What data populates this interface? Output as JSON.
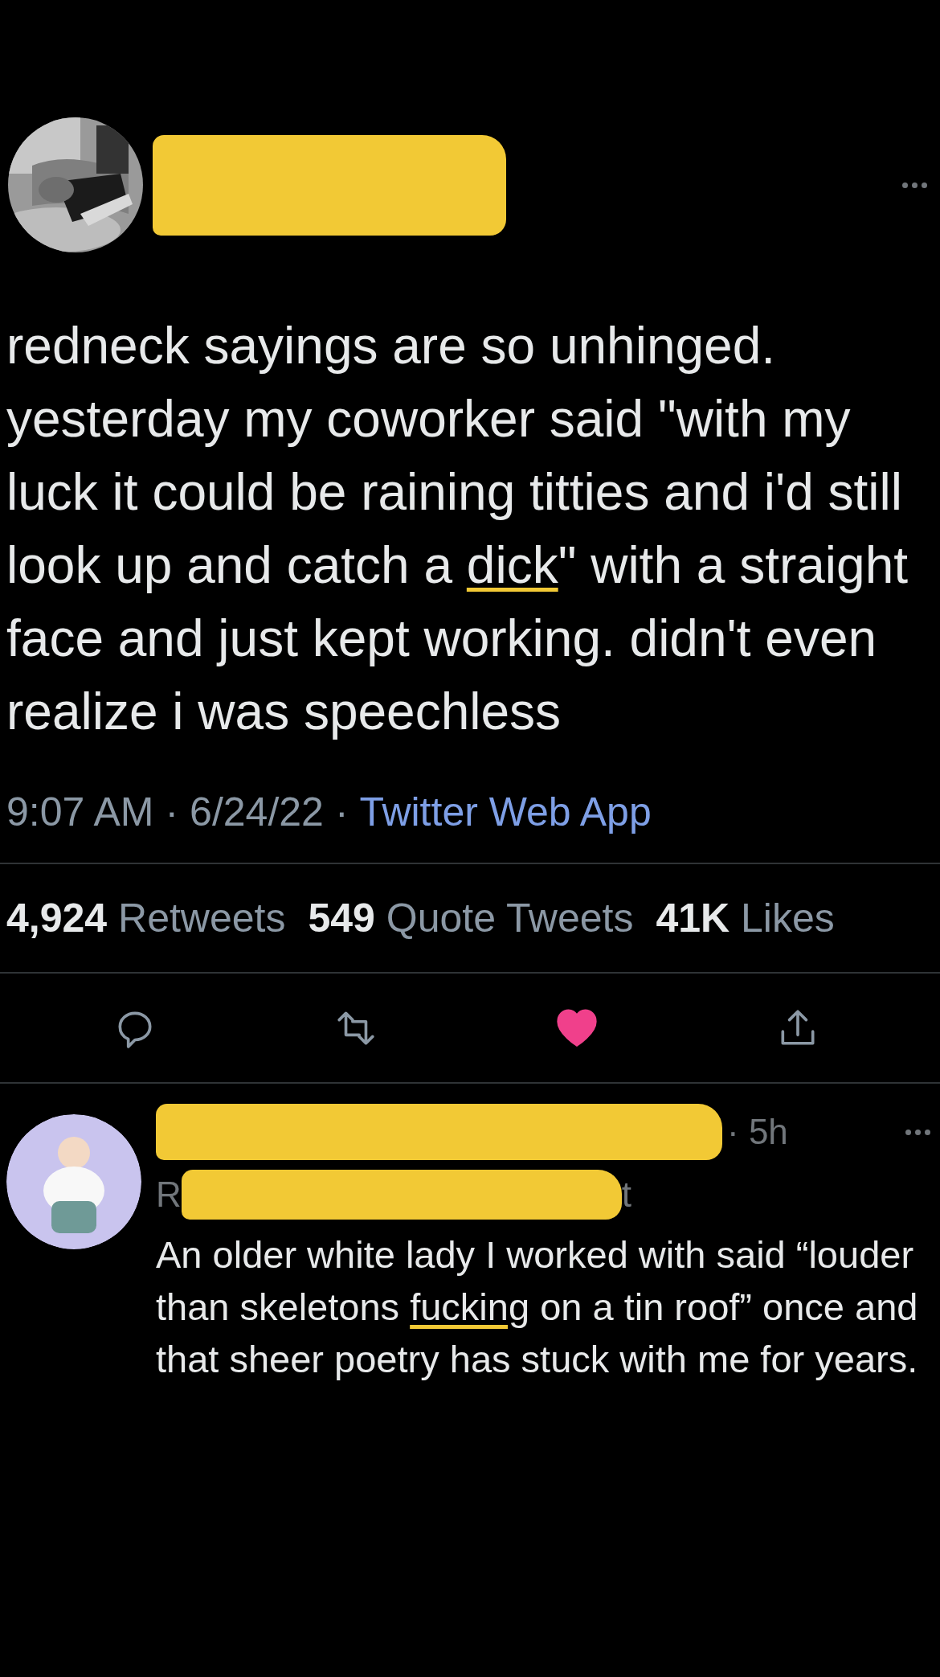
{
  "tweet": {
    "text": [
      {
        "text": "redneck sayings are so unhinged. yesterday my coworker said \"with my luck it could be raining titties and i'd still look up and catch a ",
        "censored": false
      },
      {
        "text": "dick",
        "censored": true
      },
      {
        "text": "\" with a straight face and just kept working. didn't even realize i was speechless",
        "censored": false
      }
    ],
    "time": "9:07 AM",
    "separator_1": "·",
    "date": "6/24/22",
    "separator_2": "·",
    "source": "Twitter Web App",
    "stats": [
      {
        "count": "4,924",
        "label": "Retweets"
      },
      {
        "count": "549",
        "label": "Quote Tweets"
      },
      {
        "count": "41K",
        "label": "Likes"
      }
    ],
    "actions": [
      {
        "kind": "reply",
        "on": false
      },
      {
        "kind": "retweet",
        "on": false
      },
      {
        "kind": "like",
        "on": true
      },
      {
        "kind": "share",
        "on": false
      }
    ]
  },
  "reply": {
    "time": "· 5h",
    "handle_start": "R",
    "handle_end": "t",
    "text": [
      {
        "text": "An older white lady I worked with said “louder than skeletons ",
        "censored": false
      },
      {
        "text": "fucking",
        "censored": true
      },
      {
        "text": " on a tin roof” once and that sheer poetry has stuck with me for years.",
        "censored": false
      }
    ]
  }
}
